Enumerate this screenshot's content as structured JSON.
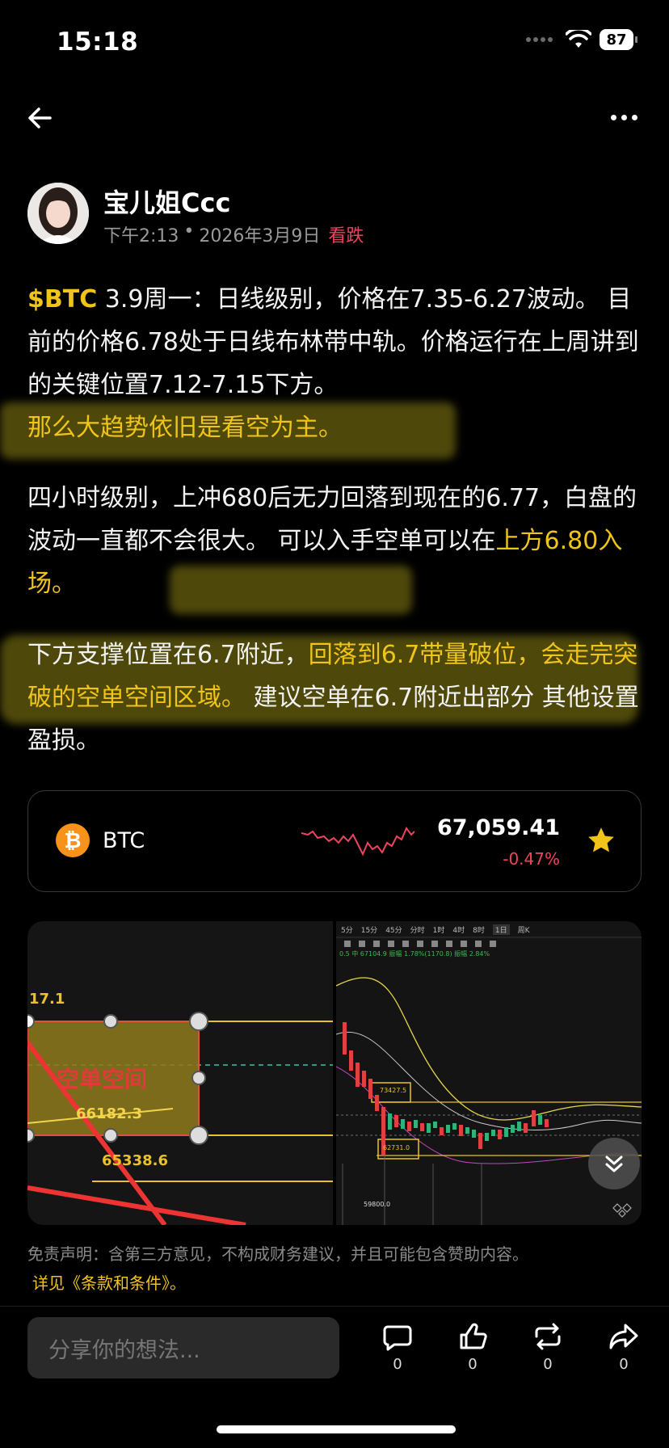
{
  "status_bar": {
    "time": "15:18",
    "battery": "87"
  },
  "author": {
    "name": "宝儿姐Ccc",
    "time": "下午2:13",
    "date": "2026年3月9日",
    "sentiment": "看跌"
  },
  "post": {
    "p1_ticker": "$BTC",
    "p1_text": " 3.9周一：日线级别，价格在7.35-6.27波动。 目前的价格6.78处于日线布林带中轨。价格运行在上周讲到的关键位置7.12-7.15下方。",
    "p1_highlight": "那么大趋势依旧是看空为主。",
    "p2_text": "四小时级别，上冲680后无力回落到现在的6.77，白盘的波动一直都不会很大。 可以入手空单可以在",
    "p2_highlight": "上方6.80入场。",
    "p3_text": "下方支撑位置在6.7附近，",
    "p3_highlight": "回落到6.7带量破位，会走完突破的空单空间区域。",
    "p3_text2": " 建议空单在6.7附近出部分 其他设置盈损。"
  },
  "ticker": {
    "symbol": "BTC",
    "price": "67,059.41",
    "change": "-0.47%"
  },
  "image1": {
    "level_top": "17.1",
    "zone_label": "空单空间",
    "level_mid": "66182.3",
    "level_low": "65338.6"
  },
  "image2": {
    "tabs": [
      "5分",
      "15分",
      "45分",
      "分时",
      "1时",
      "4时",
      "8时",
      "1日",
      "周K"
    ],
    "indicator_line": "0.5  中 67104.9  振幅 1.78%(1170.8)  振幅 2.84%",
    "box_high": "73427.5",
    "box_low": "62731.0",
    "min_price": "59800.0"
  },
  "disclaimer": "免责声明：含第三方意见，不构成财务建议，并且可能包含赞助内容。",
  "terms": "详见《条款和条件》。",
  "bottom": {
    "placeholder": "分享你的想法...",
    "comment_count": "0",
    "like_count": "0",
    "repost_count": "0",
    "share_count": "0"
  },
  "colors": {
    "accent": "#f0c419",
    "bearish": "#f0445c",
    "background": "#000000"
  }
}
